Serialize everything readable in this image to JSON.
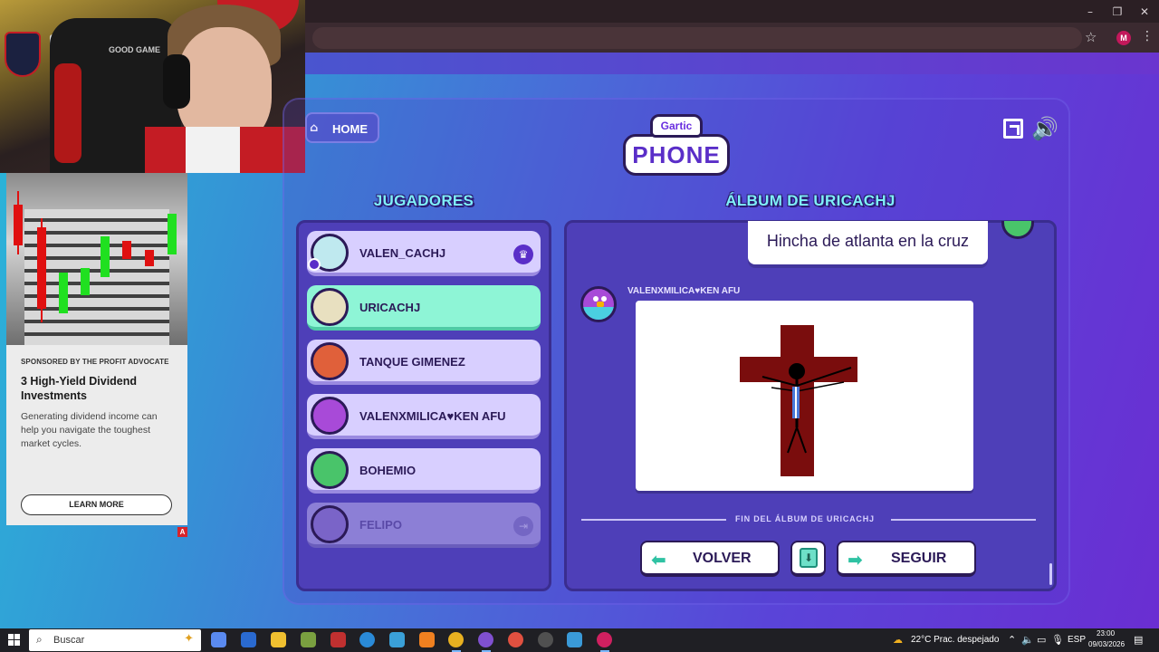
{
  "browser": {
    "minimize": "–",
    "restore": "❐",
    "close": "✕",
    "profile_initial": "M"
  },
  "ad": {
    "sponsor": "SPONSORED BY THE PROFIT ADVOCATE",
    "title": "3 High-Yield Dividend Investments",
    "body": "Generating dividend income can help you navigate the toughest market cycles.",
    "button": "LEARN MORE",
    "choice_badge": "A"
  },
  "webcam": {
    "chair_label": "GOOD GAME"
  },
  "game": {
    "home_label": "HOME",
    "logo_top": "Gartic",
    "logo_main": "PHONE",
    "players_title": "JUGADORES",
    "album_title": "ÁLBUM DE URICACHJ",
    "players": [
      {
        "name": "VALEN_CACHJ",
        "avatar_color": "#bfe9ef",
        "state": "normal",
        "badge": "crown"
      },
      {
        "name": "URICACHJ",
        "avatar_color": "#e8e0c0",
        "state": "active",
        "badge": ""
      },
      {
        "name": "TANQUE GIMENEZ",
        "avatar_color": "#e0603a",
        "state": "normal",
        "badge": ""
      },
      {
        "name": "VALENXMILICA♥KEN AFU",
        "avatar_color": "#a84ad8",
        "state": "normal",
        "badge": ""
      },
      {
        "name": "BOHEMIO",
        "avatar_color": "#49c46a",
        "state": "normal",
        "badge": ""
      },
      {
        "name": "FELIPO",
        "avatar_color": "#7a64c8",
        "state": "disabled",
        "badge": "exit"
      }
    ],
    "album": {
      "caption": "Hincha de atlanta en la cruz",
      "drawer_name": "VALENXMILICA♥KEN AFU",
      "end_text": "FIN DEL ÁLBUM DE URICACHJ",
      "back_label": "VOLVER",
      "next_label": "SEGUIR"
    },
    "colors": {
      "cross": "#7a0d0d",
      "accent": "#7ff0f8",
      "panel": "#4e3fb8"
    }
  },
  "taskbar": {
    "search_placeholder": "Buscar",
    "weather": "22°C  Prac. despejado",
    "language": "ESP",
    "time": "23:00",
    "date": "09/03/2026"
  }
}
